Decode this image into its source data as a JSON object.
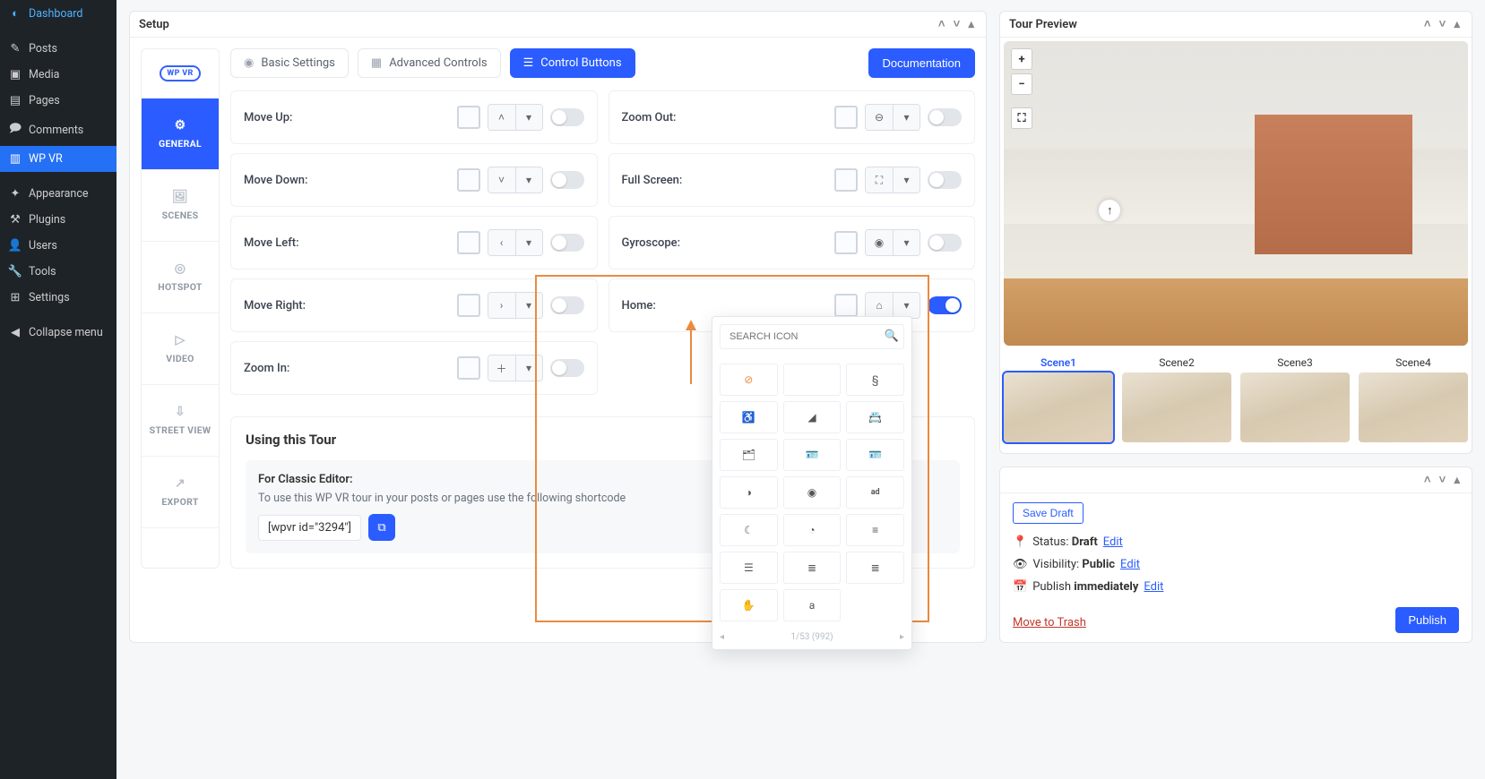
{
  "sidebar": {
    "items": [
      {
        "icon": "◐",
        "label": "Dashboard"
      },
      {
        "icon": "✎",
        "label": "Posts"
      },
      {
        "icon": "▣",
        "label": "Media"
      },
      {
        "icon": "▤",
        "label": "Pages"
      },
      {
        "icon": "🗩",
        "label": "Comments"
      },
      {
        "icon": "▥",
        "label": "WP VR"
      },
      {
        "icon": "✦",
        "label": "Appearance"
      },
      {
        "icon": "⚒",
        "label": "Plugins"
      },
      {
        "icon": "👤",
        "label": "Users"
      },
      {
        "icon": "🔧",
        "label": "Tools"
      },
      {
        "icon": "⊞",
        "label": "Settings"
      },
      {
        "icon": "◀",
        "label": "Collapse menu"
      }
    ]
  },
  "setup": {
    "title": "Setup",
    "logo": "WP VR",
    "vtabs": [
      "GENERAL",
      "SCENES",
      "HOTSPOT",
      "VIDEO",
      "STREET VIEW",
      "EXPORT"
    ],
    "top_tabs": {
      "basic": "Basic Settings",
      "advanced": "Advanced Controls",
      "control": "Control Buttons"
    },
    "documentation_btn": "Documentation",
    "controls_left": [
      {
        "label": "Move Up:",
        "icon": "˄"
      },
      {
        "label": "Move Down:",
        "icon": "˅"
      },
      {
        "label": "Move Left:",
        "icon": "‹"
      },
      {
        "label": "Move Right:",
        "icon": "›"
      },
      {
        "label": "Zoom In:",
        "icon": "＋"
      }
    ],
    "controls_right": [
      {
        "label": "Zoom Out:",
        "icon": "⊖"
      },
      {
        "label": "Full Screen:",
        "icon": "⛶"
      },
      {
        "label": "Gyroscope:",
        "icon": "◉"
      },
      {
        "label": "Home:",
        "icon": "⌂",
        "toggled": true
      }
    ],
    "using": {
      "heading": "Using this Tour",
      "classic": "For Classic Editor:",
      "classic_desc": "To use this WP VR tour in your posts or pages use the following shortcode",
      "shortcode": "[wpvr id=\"3294\"]"
    },
    "icon_picker": {
      "placeholder": "SEARCH ICON",
      "pager": "1/53 (992)"
    }
  },
  "preview": {
    "title": "Tour Preview",
    "scenes": [
      "Scene1",
      "Scene2",
      "Scene3",
      "Scene4"
    ]
  },
  "publish": {
    "save_draft": "Save Draft",
    "status_key": "Status:",
    "status_val": "Draft",
    "vis_key": "Visibility:",
    "vis_val": "Public",
    "pub_key": "Publish",
    "pub_val": "immediately",
    "edit": "Edit",
    "trash": "Move to Trash",
    "btn": "Publish"
  }
}
